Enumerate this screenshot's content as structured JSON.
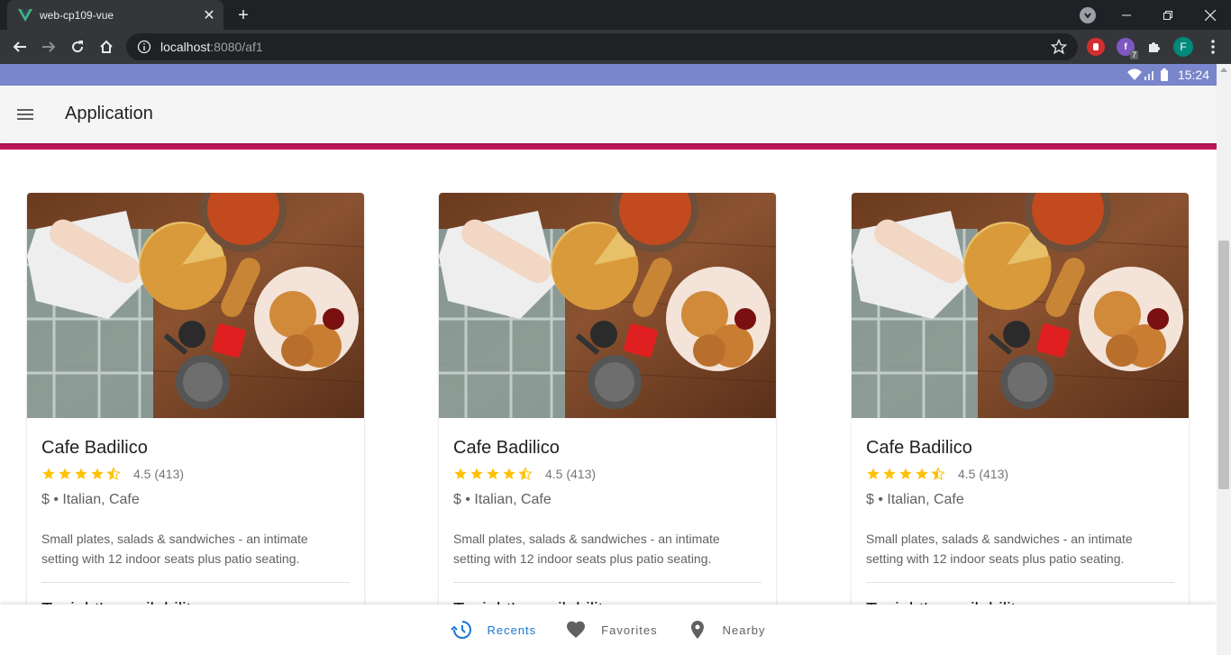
{
  "browser": {
    "tab_title": "web-cp109-vue",
    "url_host": "localhost",
    "url_path": ":8080/af1",
    "profile_initial": "F",
    "ext_badge": "7"
  },
  "status": {
    "time": "15:24"
  },
  "app": {
    "title": "Application"
  },
  "cards": [
    {
      "title": "Cafe Badilico",
      "rating_value": 4.5,
      "rating_text": "4.5 (413)",
      "meta": "$ • Italian, Cafe",
      "description": "Small plates, salads & sandwiches - an intimate setting with 12 indoor seats plus patio seating.",
      "subtitle": "Tonight's availability"
    },
    {
      "title": "Cafe Badilico",
      "rating_value": 4.5,
      "rating_text": "4.5 (413)",
      "meta": "$ • Italian, Cafe",
      "description": "Small plates, salads & sandwiches - an intimate setting with 12 indoor seats plus patio seating.",
      "subtitle": "Tonight's availability"
    },
    {
      "title": "Cafe Badilico",
      "rating_value": 4.5,
      "rating_text": "4.5 (413)",
      "meta": "$ • Italian, Cafe",
      "description": "Small plates, salads & sandwiches - an intimate setting with 12 indoor seats plus patio seating.",
      "subtitle": "Tonight's availability"
    }
  ],
  "bottom_nav": [
    {
      "label": "Recents",
      "icon": "history-icon",
      "active": true
    },
    {
      "label": "Favorites",
      "icon": "heart-icon",
      "active": false
    },
    {
      "label": "Nearby",
      "icon": "map-marker-icon",
      "active": false
    }
  ],
  "colors": {
    "status_bar": "#7986cb",
    "accent_bar": "#c2185b",
    "active_nav": "#1976d2",
    "star": "#ffc107"
  }
}
